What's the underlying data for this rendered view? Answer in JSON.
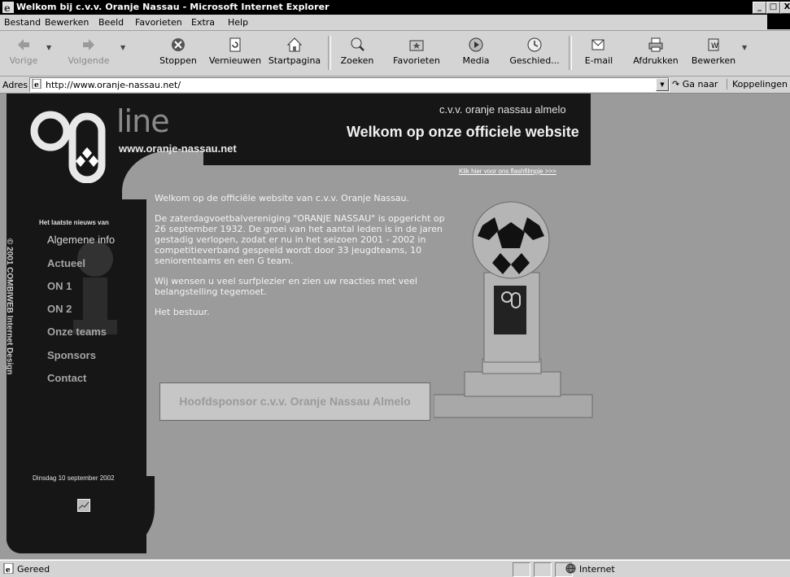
{
  "window": {
    "title": "Welkom bij c.v.v. Oranje Nassau - Microsoft Internet Explorer",
    "controls": {
      "minimize": "_",
      "maximize": "□",
      "close": "X"
    }
  },
  "menu": [
    "Bestand",
    "Bewerken",
    "Beeld",
    "Favorieten",
    "Extra",
    "Help"
  ],
  "toolbar": {
    "back": "Vorige",
    "forward": "Volgende",
    "stop": "Stoppen",
    "refresh": "Vernieuwen",
    "home": "Startpagina",
    "search": "Zoeken",
    "favorites": "Favorieten",
    "media": "Media",
    "history": "Geschied...",
    "mail": "E-mail",
    "print": "Afdrukken",
    "edit": "Bewerken"
  },
  "address": {
    "label": "Adres",
    "url": "http://www.oranje-nassau.net/",
    "go": "Ga naar",
    "links": "Koppelingen"
  },
  "page": {
    "logo_text": "line",
    "site_url": "www.oranje-nassau.net",
    "club_name": "c.v.v. oranje nassau almelo",
    "welcome_title": "Welkom op onze officiele website",
    "flash_link": "Klik hier voor ons flashfilmpje >>>",
    "copyright": "© 2001 COMBIWEB Internet Design",
    "news_label": "Het laatste nieuws van",
    "nav": [
      "Algemene info",
      "Actueel",
      "ON 1",
      "ON 2",
      "Onze teams",
      "Sponsors",
      "Contact"
    ],
    "date": "Dinsdag 10 september 2002",
    "paragraphs": [
      "Welkom op de officiële website van c.v.v. Oranje Nassau.",
      "De zaterdagvoetbalvereniging \"ORANJE NASSAU\" is opgericht op 26 september 1932. De groei van het aantal leden is in de jaren gestadig verlopen, zodat er nu in het seizoen 2001 - 2002 in competitieverband gespeeld wordt door 33 jeugdteams, 10 seniorenteams en een G team.",
      "Wij wensen u veel surfplezier en zien uw reacties met veel belangstelling tegemoet.",
      "Het bestuur."
    ],
    "sponsor": "Hoofdsponsor c.v.v. Oranje Nassau Almelo"
  },
  "status": {
    "text": "Gereed",
    "zone": "Internet"
  }
}
